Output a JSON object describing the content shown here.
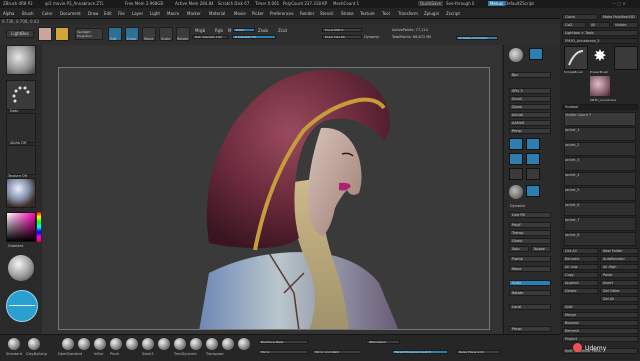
{
  "titlebar": {
    "items": [
      "ZBrush 4R8 P2",
      "qr2 movie P3_Annabrace.ZTL",
      "Free Mem 2.968GB",
      "Active Mem 284.84",
      "Scratch Disk 67",
      "Timer 0.061",
      "PolyCount 237.318 KP",
      "MeshCount 1"
    ],
    "right_items": [
      "QuickSave",
      "See-through 0",
      "Menus",
      "DefaultZScript"
    ]
  },
  "menubar": {
    "items": [
      "Alpha",
      "Brush",
      "Color",
      "Document",
      "Draw",
      "Edit",
      "File",
      "Layer",
      "Light",
      "Macro",
      "Marker",
      "Material",
      "Movie",
      "Picker",
      "Preferences",
      "Render",
      "Stencil",
      "Stroke",
      "Texture",
      "Tool",
      "Transform",
      "Zplugin",
      "Zscript"
    ]
  },
  "coords": "0.736, 0.706, 0.43",
  "topshelf": {
    "lightbox": "LightBox",
    "spotlight": "Spotlight Projection",
    "modes": [
      "Edit",
      "Draw",
      "Move",
      "Scale",
      "Rotate"
    ],
    "mrgb": "Mrgb",
    "rgb": "Rgb",
    "m": "M",
    "zadd": "Zadd",
    "zsub": "Zsub",
    "zcut": "Zcut",
    "focal_shift": "Focal Shift 0",
    "draw_size": "Draw Size 64",
    "dynamic": "Dynamic",
    "rgb_intensity": "Rgb Intensity 100",
    "z_intensity": "Z Intensity 25",
    "active_points": "ActivePoints: 77,114",
    "total_points": "TotalPoints: 86,672 Mil",
    "activate_symmetry": "Activate Symmetry"
  },
  "left_shelf": {
    "labels": [
      "Alpha Off",
      "Texture Off",
      "Gradient"
    ]
  },
  "right_shelf": {
    "buttons": [
      "Bpr",
      "SPix 3",
      "Scroll",
      "Zoom",
      "Actual",
      "AAHalf",
      "Persp",
      "Floor",
      "Local",
      "L.Sym",
      "Frame",
      "Move",
      "Scale",
      "Rotate",
      "Line Fill",
      "PolyF",
      "Transp",
      "Ghost",
      "Solo",
      "Xpose"
    ],
    "labels": [
      "Dynamic",
      "Solo"
    ]
  },
  "tray": {
    "top_rows": [
      "Clone",
      "Make PolyMesh3D",
      "GoZ",
      "All",
      "Visible",
      "R",
      "Lightbox > Tools"
    ],
    "tool_name": "PM3D_Annabrace_5",
    "brushes": [
      "SimpleBrush",
      "EraserBrush",
      "PM3D_Annabrace"
    ],
    "subtool_header": "Subtool",
    "subtools": [
      "Visible Count 7",
      "Jacket_1",
      "Jacket_2",
      "Jacket_3",
      "Jacket_4",
      "Jacket_5",
      "Jacket_6",
      "Jacket_7",
      "Jacket_8",
      "Jacket_9",
      "Jacket_10"
    ],
    "lower_rows": [
      "List All",
      "New Folder",
      "Rename",
      "AutoReorder",
      "All Low",
      "All High",
      "Copy",
      "Paste",
      "Append",
      "Insert",
      "Delete",
      "Del Other",
      "Del All",
      "Split",
      "Merge",
      "Boolean",
      "Remesh",
      "Project",
      "Extract"
    ],
    "footer": "Split To Similar Parts"
  },
  "bottom_shelf": {
    "brushes": [
      "Standard",
      "ClayBuildup",
      "DamStandard",
      "Move",
      "Inflat",
      "Pinch",
      "Move Topo",
      "Slash3",
      "hPolish",
      "TrimDynamic",
      "ClipCurve",
      "Transpose",
      "SnakeHook",
      "Orb_Cracks"
    ],
    "left_labels": [
      "Dots",
      "Alpha Off"
    ],
    "controls": [
      "Backface Mask",
      "Mirror",
      "Mirror And Weld",
      "ZRemesher",
      "Target Polygons Count 5",
      "Relax Plane Grid"
    ],
    "udemy": "Udemy"
  }
}
